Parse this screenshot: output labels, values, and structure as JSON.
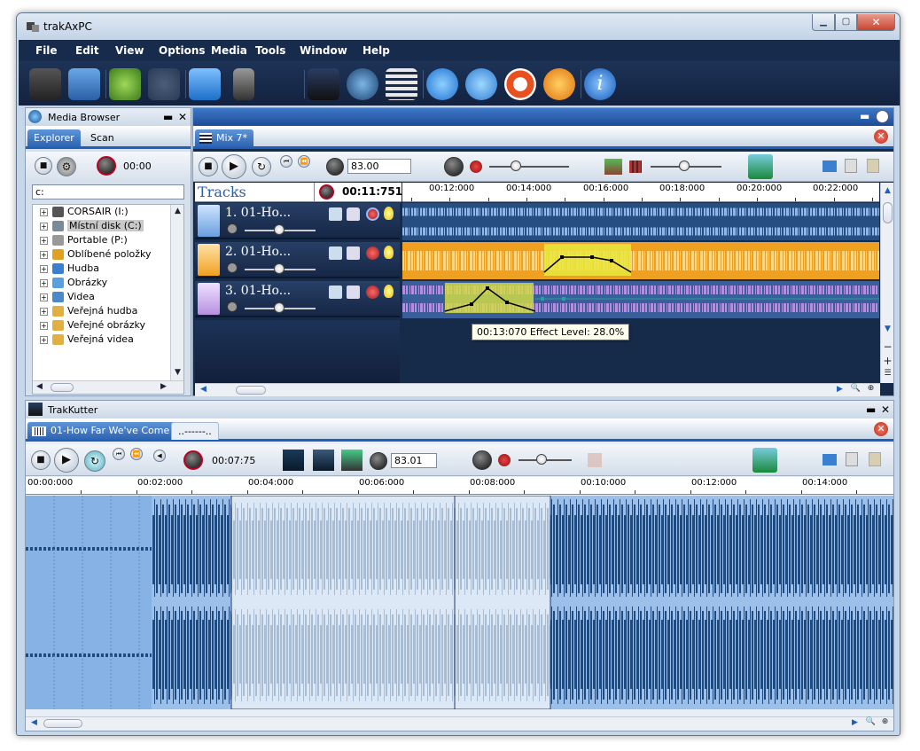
{
  "window": {
    "title": "trakAxPC"
  },
  "menu": [
    "File",
    "Edit",
    "View",
    "Options",
    "Media",
    "Tools",
    "Window",
    "Help"
  ],
  "media_browser": {
    "title": "Media Browser",
    "tabs": [
      "Explorer",
      "Scan"
    ],
    "time": "00:00",
    "path": "c:",
    "items": [
      "CORSAIR (I:)",
      "Místní disk (C:)",
      "Portable (P:)",
      "Oblíbené položky",
      "Hudba",
      "Obrázky",
      "Videa",
      "Veřejná hudba",
      "Veřejné obrázky",
      "Veřejná videa"
    ]
  },
  "mix": {
    "tab": "Mix 7*",
    "tempo": "83.00",
    "tracks_label": "Tracks",
    "position": "00:11:751",
    "ruler": [
      "00:12:000",
      "00:14:000",
      "00:16:000",
      "00:18:000",
      "00:20:000",
      "00:22:000"
    ],
    "tracks": [
      "1. 01-Ho...",
      "2. 01-Ho...",
      "3. 01-Ho..."
    ],
    "tooltip": "00:13:070  Effect Level: 28.0%"
  },
  "trakkutter": {
    "title": "TrakKutter",
    "tabs": [
      "01-How Far We've Come",
      "..------.."
    ],
    "time": "00:07:75",
    "tempo": "83.01",
    "ruler": [
      "00:00:000",
      "00:02:000",
      "00:04:000",
      "00:06:000",
      "00:08:000",
      "00:10:000",
      "00:12:000",
      "00:14:000"
    ]
  }
}
